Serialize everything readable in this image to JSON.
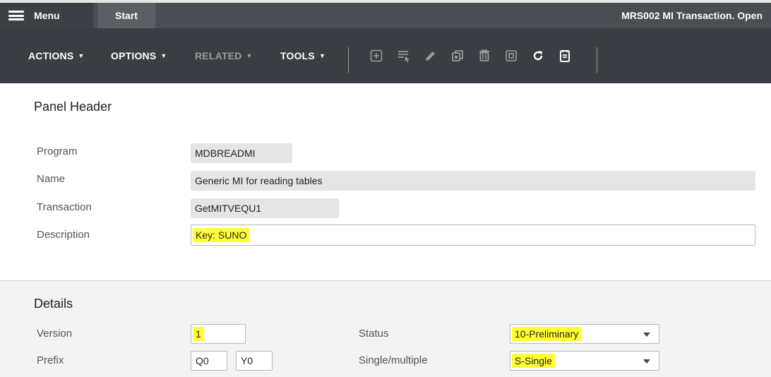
{
  "topbar": {
    "menu_label": "Menu",
    "start_label": "Start",
    "window_title": "MRS002 MI Transaction. Open"
  },
  "toolbar": {
    "actions": "ACTIONS",
    "options": "OPTIONS",
    "related": "RELATED",
    "tools": "TOOLS",
    "icons": [
      "add-icon",
      "filter-list-icon",
      "edit-icon",
      "copy-icon",
      "delete-icon",
      "display-icon",
      "refresh-icon",
      "notes-icon"
    ]
  },
  "panel_header": {
    "title": "Panel Header",
    "program_label": "Program",
    "program_value": "MDBREADMI",
    "name_label": "Name",
    "name_value": "Generic MI for reading tables",
    "transaction_label": "Transaction",
    "transaction_value": "GetMITVEQU1",
    "description_label": "Description",
    "description_value": "Key: SUNO"
  },
  "details": {
    "title": "Details",
    "version_label": "Version",
    "version_value": "1",
    "prefix_label": "Prefix",
    "prefix_value_1": "Q0",
    "prefix_value_2": "Y0",
    "status_label": "Status",
    "status_value": "10-Preliminary",
    "single_multiple_label": "Single/multiple",
    "single_multiple_value": "S-Single"
  },
  "colors": {
    "topbar": "#4a4e53",
    "toolbar": "#3a3d41",
    "highlight": "#ffff33",
    "details_bg": "#f3f3f3"
  }
}
